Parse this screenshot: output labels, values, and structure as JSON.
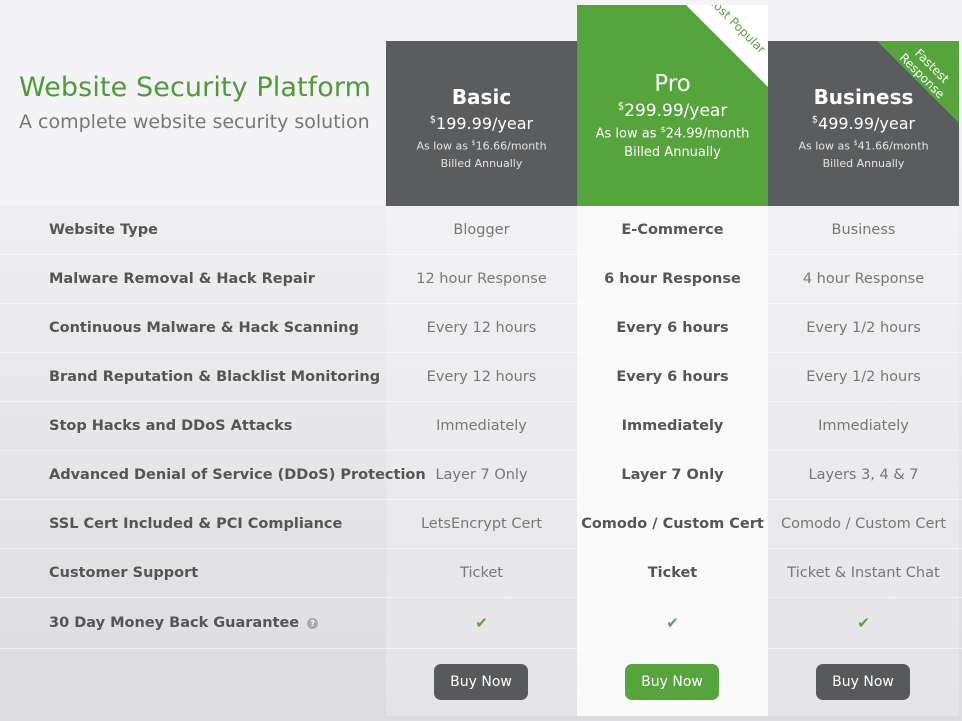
{
  "hero": {
    "title": "Website Security Platform",
    "subtitle": "A complete website security solution"
  },
  "plans": [
    {
      "name": "Basic",
      "price_symbol": "$",
      "price": "199.99",
      "price_period": "/year",
      "low_prefix": "As low as ",
      "low_symbol": "$",
      "low_value": "16.66/month",
      "billed": "Billed Annually",
      "button": "Buy Now"
    },
    {
      "name": "Pro",
      "price_symbol": "$",
      "price": "299.99",
      "price_period": "/year",
      "low_prefix": "As low as ",
      "low_symbol": "$",
      "low_value": "24.99/month",
      "billed": "Billed Annually",
      "ribbon": "Most Popular",
      "button": "Buy Now"
    },
    {
      "name": "Business",
      "price_symbol": "$",
      "price": "499.99",
      "price_period": "/year",
      "low_prefix": "As low as ",
      "low_symbol": "$",
      "low_value": "41.66/month",
      "billed": "Billed Annually",
      "ribbon": "Fastest Response",
      "button": "Buy Now"
    }
  ],
  "features": [
    {
      "label": "Website Type",
      "values": [
        "Blogger",
        "E-Commerce",
        "Business"
      ]
    },
    {
      "label": "Malware Removal & Hack Repair",
      "values": [
        "12 hour Response",
        "6 hour Response",
        "4 hour Response"
      ]
    },
    {
      "label": "Continuous Malware & Hack Scanning",
      "values": [
        "Every 12 hours",
        "Every 6 hours",
        "Every 1/2 hours"
      ]
    },
    {
      "label": "Brand Reputation & Blacklist Monitoring",
      "values": [
        "Every 12 hours",
        "Every 6 hours",
        "Every 1/2 hours"
      ]
    },
    {
      "label": "Stop Hacks and DDoS Attacks",
      "values": [
        "Immediately",
        "Immediately",
        "Immediately"
      ]
    },
    {
      "label": "Advanced Denial of Service (DDoS) Protection",
      "values": [
        "Layer 7 Only",
        "Layer 7 Only",
        "Layers 3, 4 & 7"
      ]
    },
    {
      "label": "SSL Cert Included & PCI Compliance",
      "values": [
        "LetsEncrypt Cert",
        "Comodo / Custom Cert",
        "Comodo / Custom Cert"
      ]
    },
    {
      "label": "Customer Support",
      "values": [
        "Ticket",
        "Ticket",
        "Ticket & Instant Chat"
      ]
    }
  ],
  "guarantee": {
    "label": "30 Day Money Back Guarantee",
    "help": "?",
    "check": "✔"
  },
  "colors": {
    "accent": "#56a43c",
    "dark": "#5b5c5e"
  }
}
